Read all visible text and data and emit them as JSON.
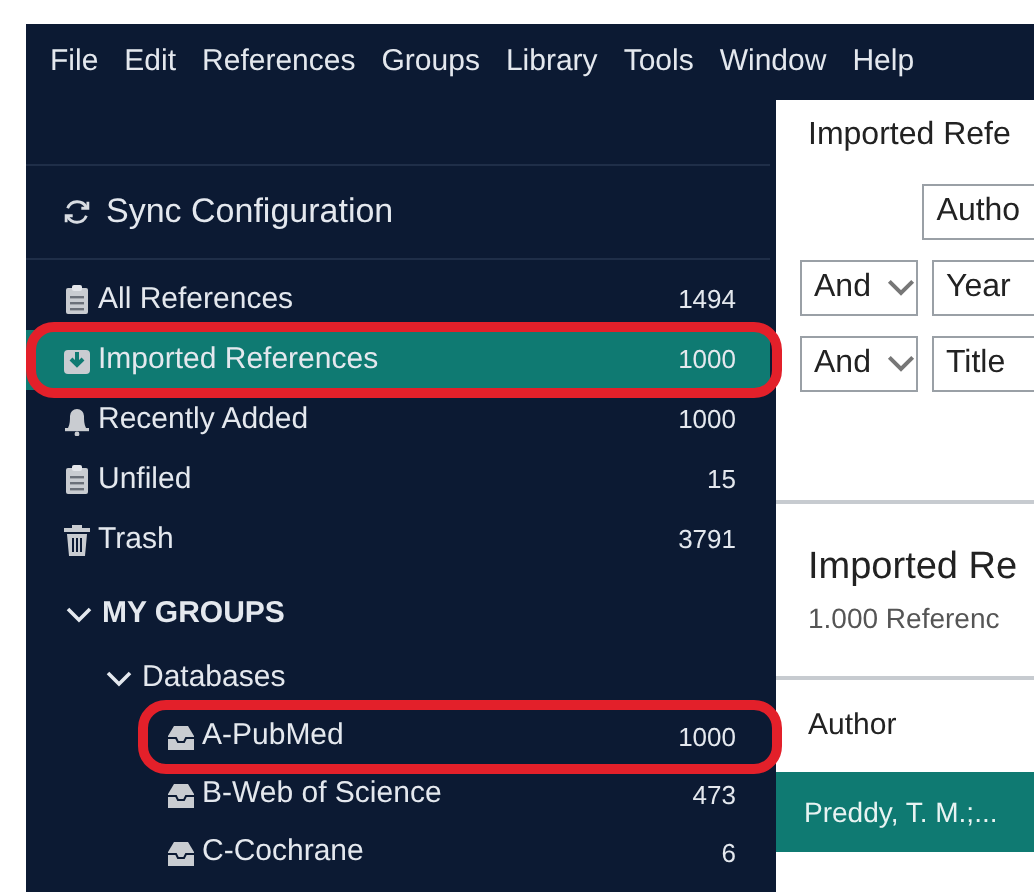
{
  "menu": [
    "File",
    "Edit",
    "References",
    "Groups",
    "Library",
    "Tools",
    "Window",
    "Help"
  ],
  "sidebar": {
    "sync": "Sync Configuration",
    "items": [
      {
        "label": "All References",
        "count": "1494",
        "kind": "clipboard",
        "selected": false,
        "highlighted": false
      },
      {
        "label": "Imported References",
        "count": "1000",
        "kind": "download",
        "selected": true,
        "highlighted": true
      },
      {
        "label": "Recently Added",
        "count": "1000",
        "kind": "bell",
        "selected": false,
        "highlighted": false
      },
      {
        "label": "Unfiled",
        "count": "15",
        "kind": "clipboard",
        "selected": false,
        "highlighted": false
      },
      {
        "label": "Trash",
        "count": "3791",
        "kind": "trash",
        "selected": false,
        "highlighted": false
      }
    ],
    "groups": {
      "label": "MY GROUPS",
      "expanded": true,
      "children": [
        {
          "label": "Databases",
          "expanded": true,
          "children": [
            {
              "label": "A-PubMed",
              "count": "1000",
              "selected": false,
              "highlighted": true
            },
            {
              "label": "B-Web of Science",
              "count": "473",
              "selected": false,
              "highlighted": false
            },
            {
              "label": "C-Cochrane",
              "count": "6",
              "selected": false,
              "highlighted": false
            }
          ]
        }
      ]
    }
  },
  "panel": {
    "title": "Imported Refe",
    "search_rows": [
      {
        "field": "Autho"
      },
      {
        "operator": "And",
        "field": "Year"
      },
      {
        "operator": "And",
        "field": "Title"
      }
    ],
    "list_title": "Imported Re",
    "list_count": "1.000 Referenc",
    "columns": [
      "Author"
    ],
    "rows": [
      {
        "author": "Preddy, T. M.;...",
        "selected": true
      }
    ]
  }
}
